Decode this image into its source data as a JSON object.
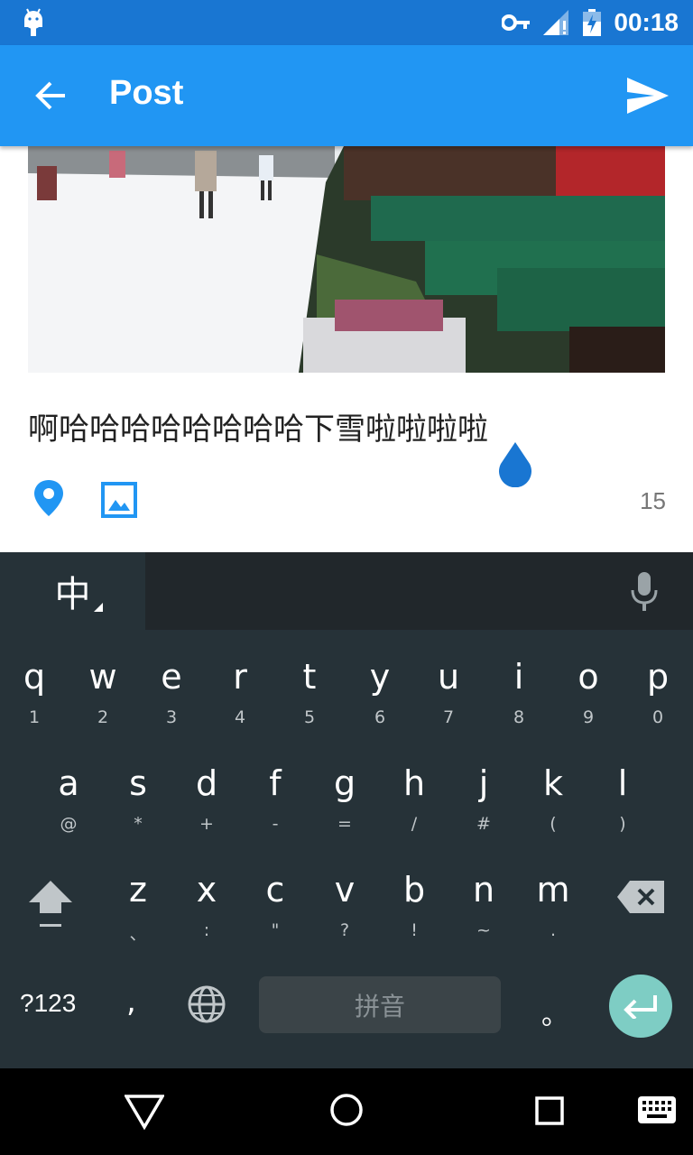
{
  "status_bar": {
    "time": "00:18",
    "icons": [
      "android-icon",
      "key-icon",
      "signal-icon",
      "battery-charging-icon"
    ]
  },
  "app_bar": {
    "title": "Post",
    "back_icon": "arrow-back-icon",
    "send_icon": "send-icon"
  },
  "post": {
    "text": "啊哈哈哈哈哈哈哈哈下雪啦啦啦啦",
    "char_count": "15",
    "photo_icon": "snow-street-photo"
  },
  "keyboard": {
    "lang_label": "中",
    "row1": [
      {
        "k": "q",
        "s": "1"
      },
      {
        "k": "w",
        "s": "2"
      },
      {
        "k": "e",
        "s": "3"
      },
      {
        "k": "r",
        "s": "4"
      },
      {
        "k": "t",
        "s": "5"
      },
      {
        "k": "y",
        "s": "6"
      },
      {
        "k": "u",
        "s": "7"
      },
      {
        "k": "i",
        "s": "8"
      },
      {
        "k": "o",
        "s": "9"
      },
      {
        "k": "p",
        "s": "0"
      }
    ],
    "row2": [
      {
        "k": "a",
        "s": "@"
      },
      {
        "k": "s",
        "s": "*"
      },
      {
        "k": "d",
        "s": "+"
      },
      {
        "k": "f",
        "s": "-"
      },
      {
        "k": "g",
        "s": "="
      },
      {
        "k": "h",
        "s": "/"
      },
      {
        "k": "j",
        "s": "#"
      },
      {
        "k": "k",
        "s": "("
      },
      {
        "k": "l",
        "s": ")"
      }
    ],
    "row3": [
      {
        "k": "z",
        "s": "、"
      },
      {
        "k": "x",
        "s": ":"
      },
      {
        "k": "c",
        "s": "\""
      },
      {
        "k": "v",
        "s": "?"
      },
      {
        "k": "b",
        "s": "!"
      },
      {
        "k": "n",
        "s": "~"
      },
      {
        "k": "m",
        "s": "."
      }
    ],
    "sym_label": "?123",
    "comma_label": ",",
    "space_label": "拼音",
    "period_label": "。"
  },
  "colors": {
    "status_bar": "#1976d2",
    "app_bar": "#2196f3",
    "accent": "#2196f3",
    "keyboard_bg": "#263238",
    "enter_key": "#7ecdc4"
  }
}
